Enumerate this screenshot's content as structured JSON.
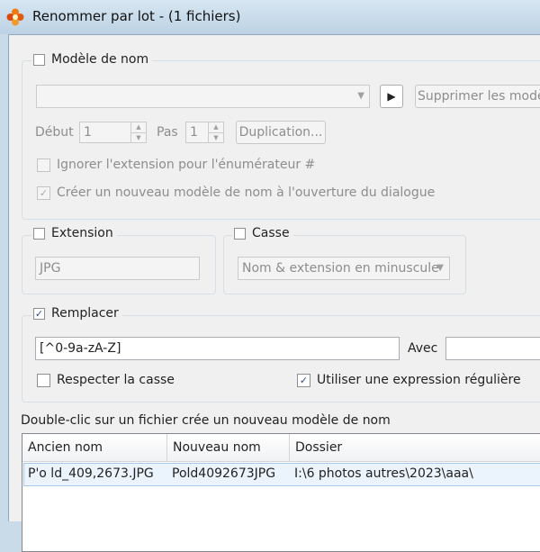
{
  "window": {
    "title": "Renommer par lot - (1 fichiers)",
    "icon": "app-flower-icon"
  },
  "name_model": {
    "checkbox_label": "Modèle de nom",
    "checked": false,
    "combo_value": "",
    "delete_button": "Supprimer les modèle",
    "start_label": "Début",
    "start_value": "1",
    "step_label": "Pas",
    "step_value": "1",
    "duplicate_button": "Duplication...",
    "ignore_ext_label": "Ignorer l'extension pour l'énumérateur #",
    "ignore_ext_checked": false,
    "create_model_label": "Créer un nouveau modèle de nom à l'ouverture du dialogue",
    "create_model_checked": true
  },
  "extension": {
    "checkbox_label": "Extension",
    "checked": false,
    "value": "JPG"
  },
  "case": {
    "checkbox_label": "Casse",
    "checked": false,
    "value": "Nom & extension en minuscule"
  },
  "replace": {
    "checkbox_label": "Remplacer",
    "checked": true,
    "pattern": "[^0-9a-zA-Z]",
    "with_label": "Avec",
    "with_value": "",
    "match_case_label": "Respecter la casse",
    "match_case_checked": false,
    "regex_label": "Utiliser une expression régulière",
    "regex_checked": true
  },
  "hint": "Double-clic sur un fichier crée un nouveau modèle de nom",
  "files": {
    "columns": [
      "Ancien nom",
      "Nouveau nom",
      "Dossier"
    ],
    "rows": [
      {
        "old": "P'o ld_409,2673.JPG",
        "new": "Pold4092673JPG",
        "folder": "I:\\6 photos autres\\2023\\aaa\\"
      }
    ]
  }
}
